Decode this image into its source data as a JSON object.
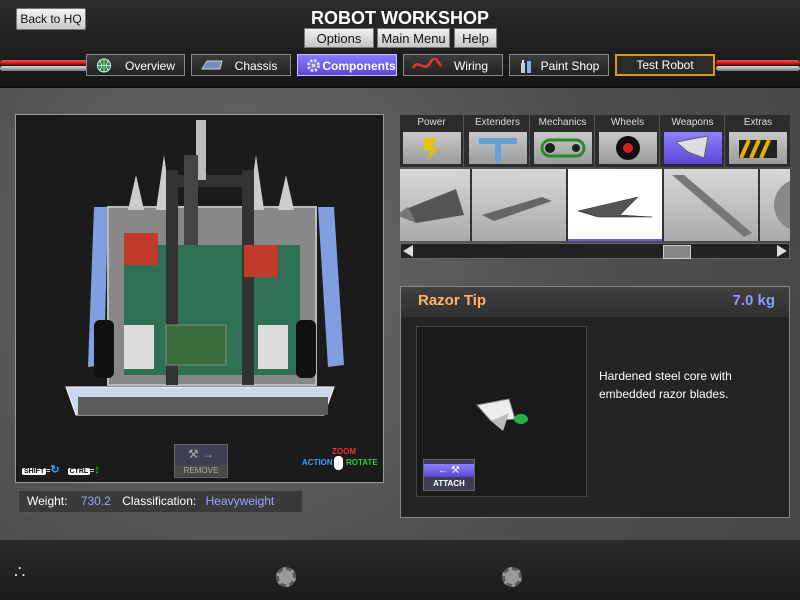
{
  "app": {
    "title": "ROBOT WORKSHOP",
    "back_label": "Back to HQ"
  },
  "nav_tabs": [
    {
      "label": "Overview",
      "icon": "globe-icon"
    },
    {
      "label": "Chassis",
      "icon": "chassis-icon"
    },
    {
      "label": "Components",
      "icon": "gear-icon",
      "active": true
    },
    {
      "label": "Wiring",
      "icon": "wire-icon"
    },
    {
      "label": "Paint Shop",
      "icon": "paint-icon"
    },
    {
      "label": "Test Robot",
      "icon": "hazard-stripes"
    }
  ],
  "controls": {
    "shift_key": "SHIFT",
    "ctrl_key": "CTRL",
    "equals": "=",
    "remove_label": "REMOVE",
    "action_label": "ACTION",
    "zoom_label": "ZOOM",
    "rotate_label": "ROTATE"
  },
  "stats": {
    "weight_label": "Weight:",
    "weight_value": "730.2",
    "class_label": "Classification:",
    "class_value": "Heavyweight"
  },
  "categories": [
    "Power",
    "Extenders",
    "Mechanics",
    "Wheels",
    "Weapons",
    "Extras"
  ],
  "selected_category": "Weapons",
  "detail": {
    "name": "Razor Tip",
    "weight": "7.0 kg",
    "description": "Hardened steel core with embedded razor blades.",
    "attach_label": "ATTACH"
  },
  "bottom_buttons": [
    "Options",
    "Main Menu",
    "Help"
  ],
  "colors": {
    "accent": "#6b5cf0",
    "weight_orange": "#ffb36a",
    "value_blue": "#8e9bff",
    "test_border": "#d99a1a"
  }
}
